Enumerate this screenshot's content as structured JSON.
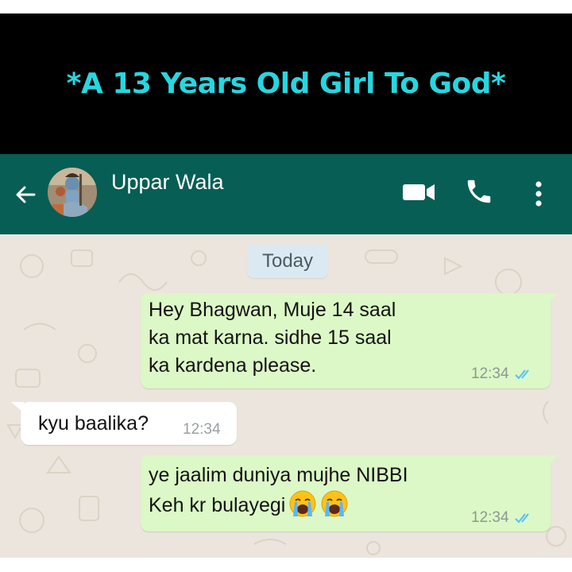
{
  "banner": {
    "title": "*A 13 Years Old Girl To God*",
    "title_color": "#26d7e0",
    "background": "#000000"
  },
  "header": {
    "contact_name": "Uppar Wala",
    "background": "#075e54",
    "icons": [
      "back-arrow-icon",
      "avatar",
      "video-call-icon",
      "phone-icon",
      "more-options-icon"
    ]
  },
  "chat": {
    "date_chip": "Today",
    "messages": [
      {
        "direction": "outgoing",
        "lines": [
          "Hey Bhagwan, Muje 14 saal",
          "ka mat karna. sidhe 15 saal",
          "ka kardena please."
        ],
        "time": "12:34",
        "status": "read-double-tick"
      },
      {
        "direction": "incoming",
        "lines": [
          "kyu baalika?"
        ],
        "time": "12:34"
      },
      {
        "direction": "outgoing",
        "lines": [
          "ye jaalim duniya mujhe NIBBI",
          "Keh kr bulayegi"
        ],
        "emojis": [
          "loudly-crying-face",
          "loudly-crying-face"
        ],
        "time": "12:34",
        "status": "read-double-tick"
      }
    ],
    "colors": {
      "outgoing_bubble": "#dcf8c6",
      "incoming_bubble": "#ffffff",
      "wallpaper": "#ece5dd",
      "tick": "#4fc3f7"
    }
  }
}
